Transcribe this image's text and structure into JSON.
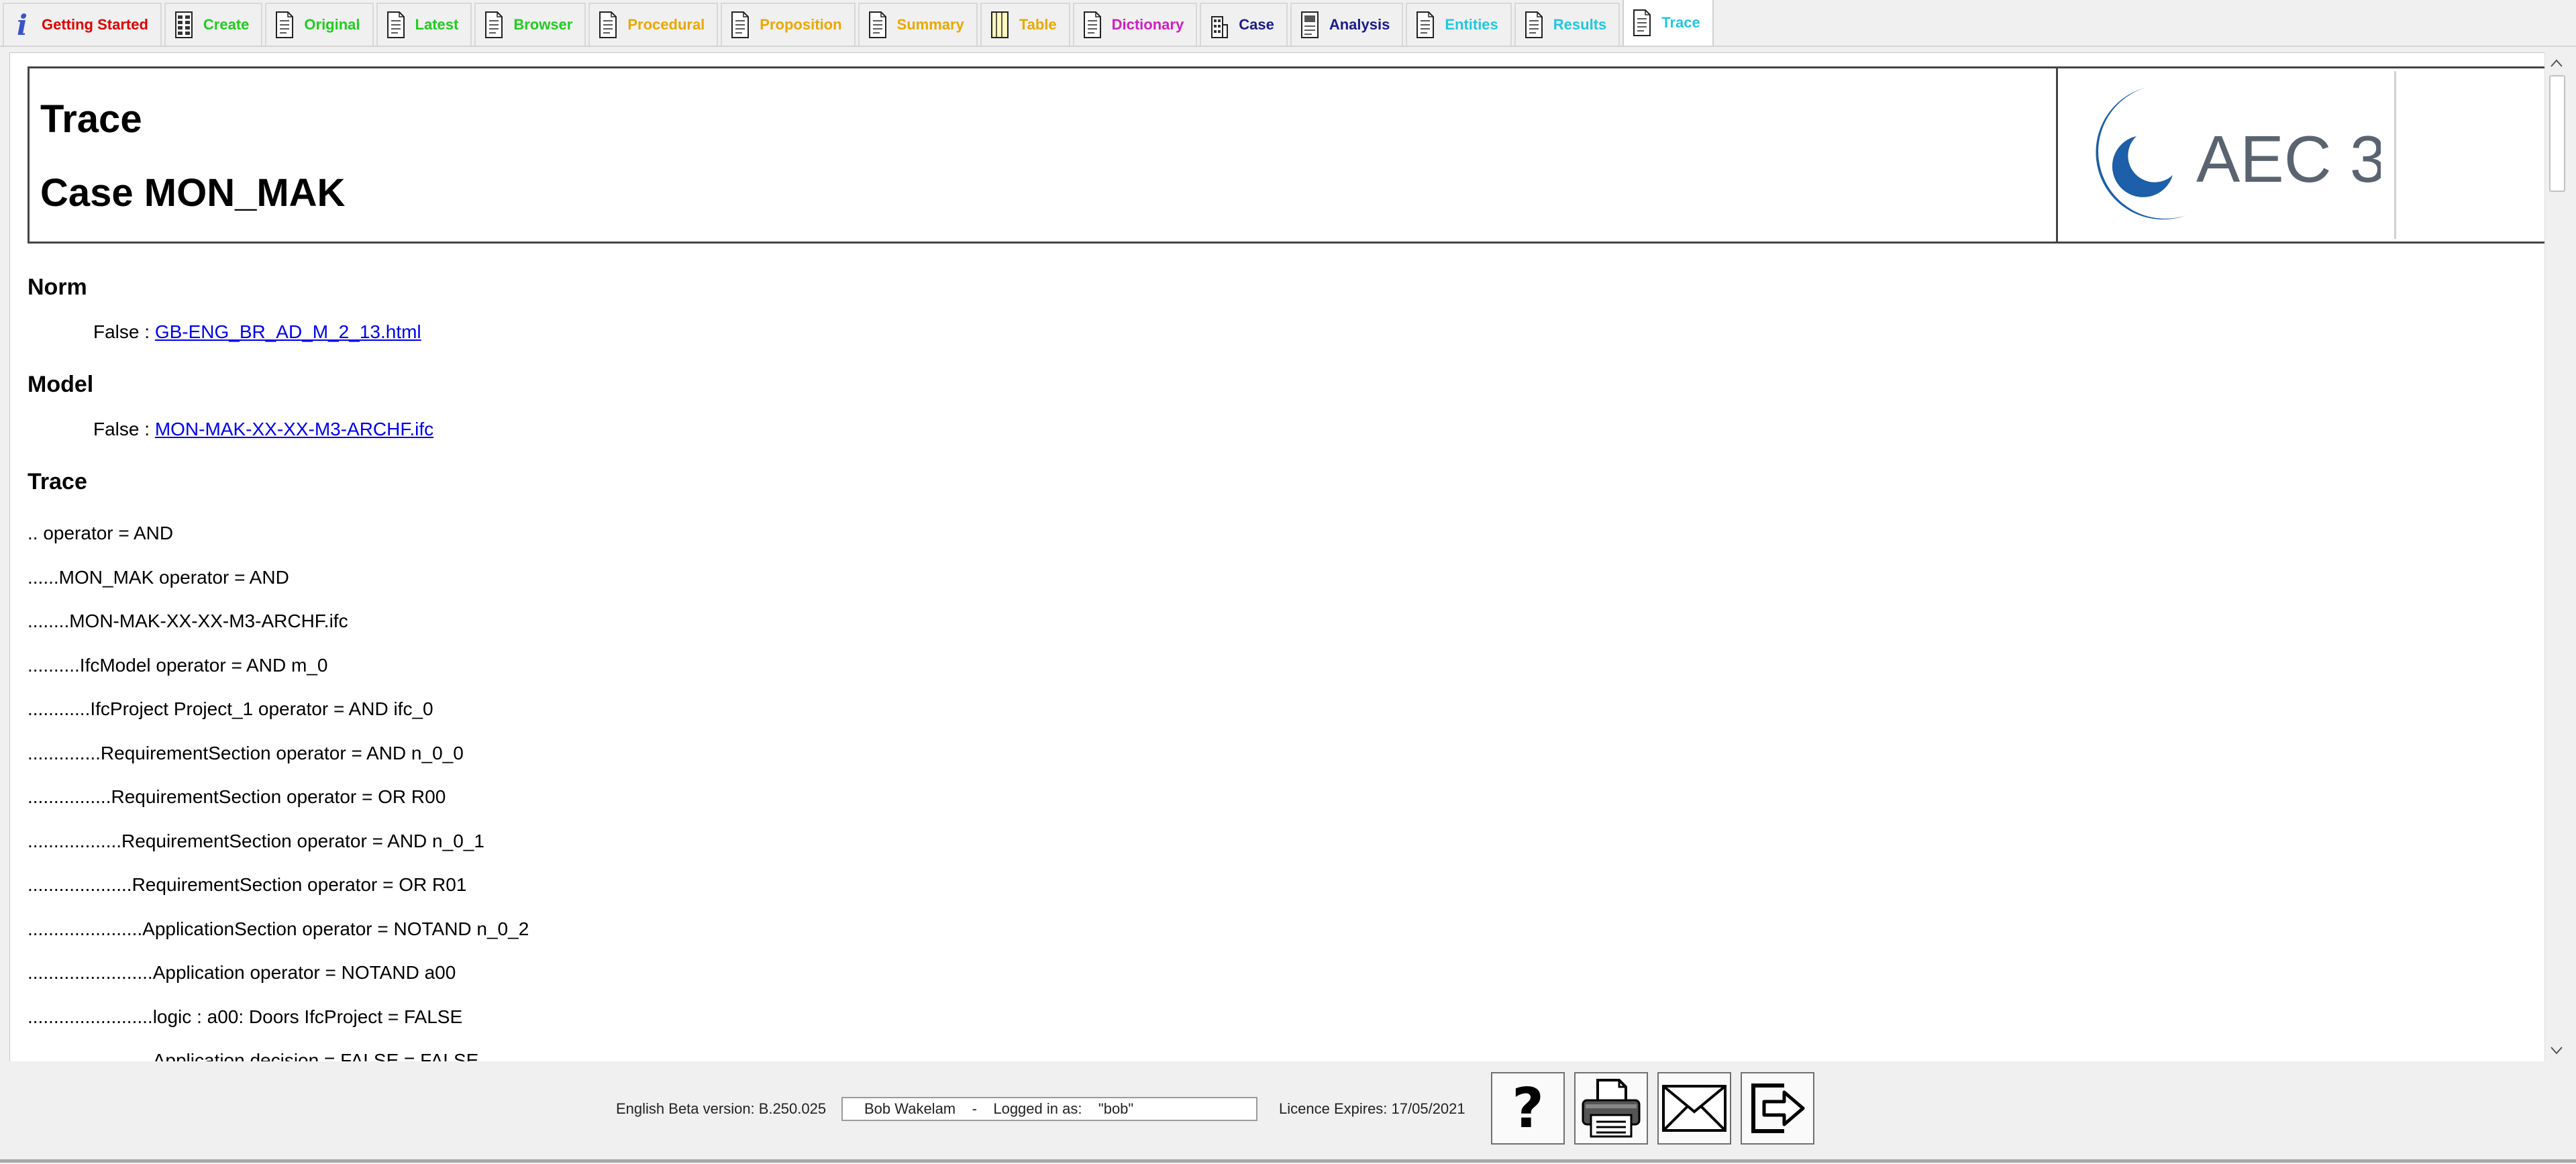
{
  "tabs": [
    {
      "label": "Getting Started",
      "color": "#e00000",
      "icon": "info-icon"
    },
    {
      "label": "Create",
      "color": "#22cc22",
      "icon": "table-icon"
    },
    {
      "label": "Original",
      "color": "#22cc22",
      "icon": "document-icon"
    },
    {
      "label": "Latest",
      "color": "#22cc22",
      "icon": "document-icon"
    },
    {
      "label": "Browser",
      "color": "#22cc22",
      "icon": "document-icon"
    },
    {
      "label": "Procedural",
      "color": "#e8a800",
      "icon": "document-icon"
    },
    {
      "label": "Proposition",
      "color": "#e8a800",
      "icon": "document-icon"
    },
    {
      "label": "Summary",
      "color": "#e8a800",
      "icon": "document-icon"
    },
    {
      "label": "Table",
      "color": "#e8a800",
      "icon": "notepad-icon"
    },
    {
      "label": "Dictionary",
      "color": "#d020c0",
      "icon": "document-icon"
    },
    {
      "label": "Case",
      "color": "#1a1a8a",
      "icon": "building-icon"
    },
    {
      "label": "Analysis",
      "color": "#1a1a8a",
      "icon": "analysis-icon"
    },
    {
      "label": "Entities",
      "color": "#22c8e0",
      "icon": "document-icon"
    },
    {
      "label": "Results",
      "color": "#22c8e0",
      "icon": "document-icon"
    },
    {
      "label": "Trace",
      "color": "#22c8e0",
      "icon": "document-icon",
      "active": true
    }
  ],
  "header": {
    "title": "Trace",
    "case": "Case MON_MAK",
    "logo_text": "AEC 3"
  },
  "norm": {
    "heading": "Norm",
    "prefix": "False : ",
    "link": "GB-ENG_BR_AD_M_2_13.html"
  },
  "model": {
    "heading": "Model",
    "prefix": "False : ",
    "link": "MON-MAK-XX-XX-M3-ARCHF.ifc"
  },
  "trace": {
    "heading": "Trace",
    "lines": [
      ".. operator = AND",
      "......MON_MAK operator = AND",
      "........MON-MAK-XX-XX-M3-ARCHF.ifc",
      "..........IfcModel operator = AND m_0",
      "............IfcProject Project_1 operator = AND ifc_0",
      "..............RequirementSection operator = AND n_0_0",
      "................RequirementSection operator = OR R00",
      "..................RequirementSection operator = AND n_0_1",
      "....................RequirementSection operator = OR R01",
      "......................ApplicationSection operator = NOTAND n_0_2",
      "........................Application operator = NOTAND a00",
      "........................logic : a00: Doors IfcProject = FALSE",
      "........................Application decision = FALSE = FALSE"
    ]
  },
  "footer": {
    "version": "English Beta version: B.250.025",
    "login": "Bob Wakelam    -    Logged in as:    \"bob\"",
    "licence": "Licence Expires: 17/05/2021",
    "buttons": [
      {
        "name": "help-button",
        "icon": "question-icon"
      },
      {
        "name": "print-button",
        "icon": "printer-icon"
      },
      {
        "name": "email-button",
        "icon": "envelope-icon"
      },
      {
        "name": "exit-button",
        "icon": "exit-icon"
      }
    ]
  },
  "colors": {
    "link": "#0000ee",
    "logo_blue": "#1d5fa8",
    "logo_grey": "#5a6470"
  }
}
